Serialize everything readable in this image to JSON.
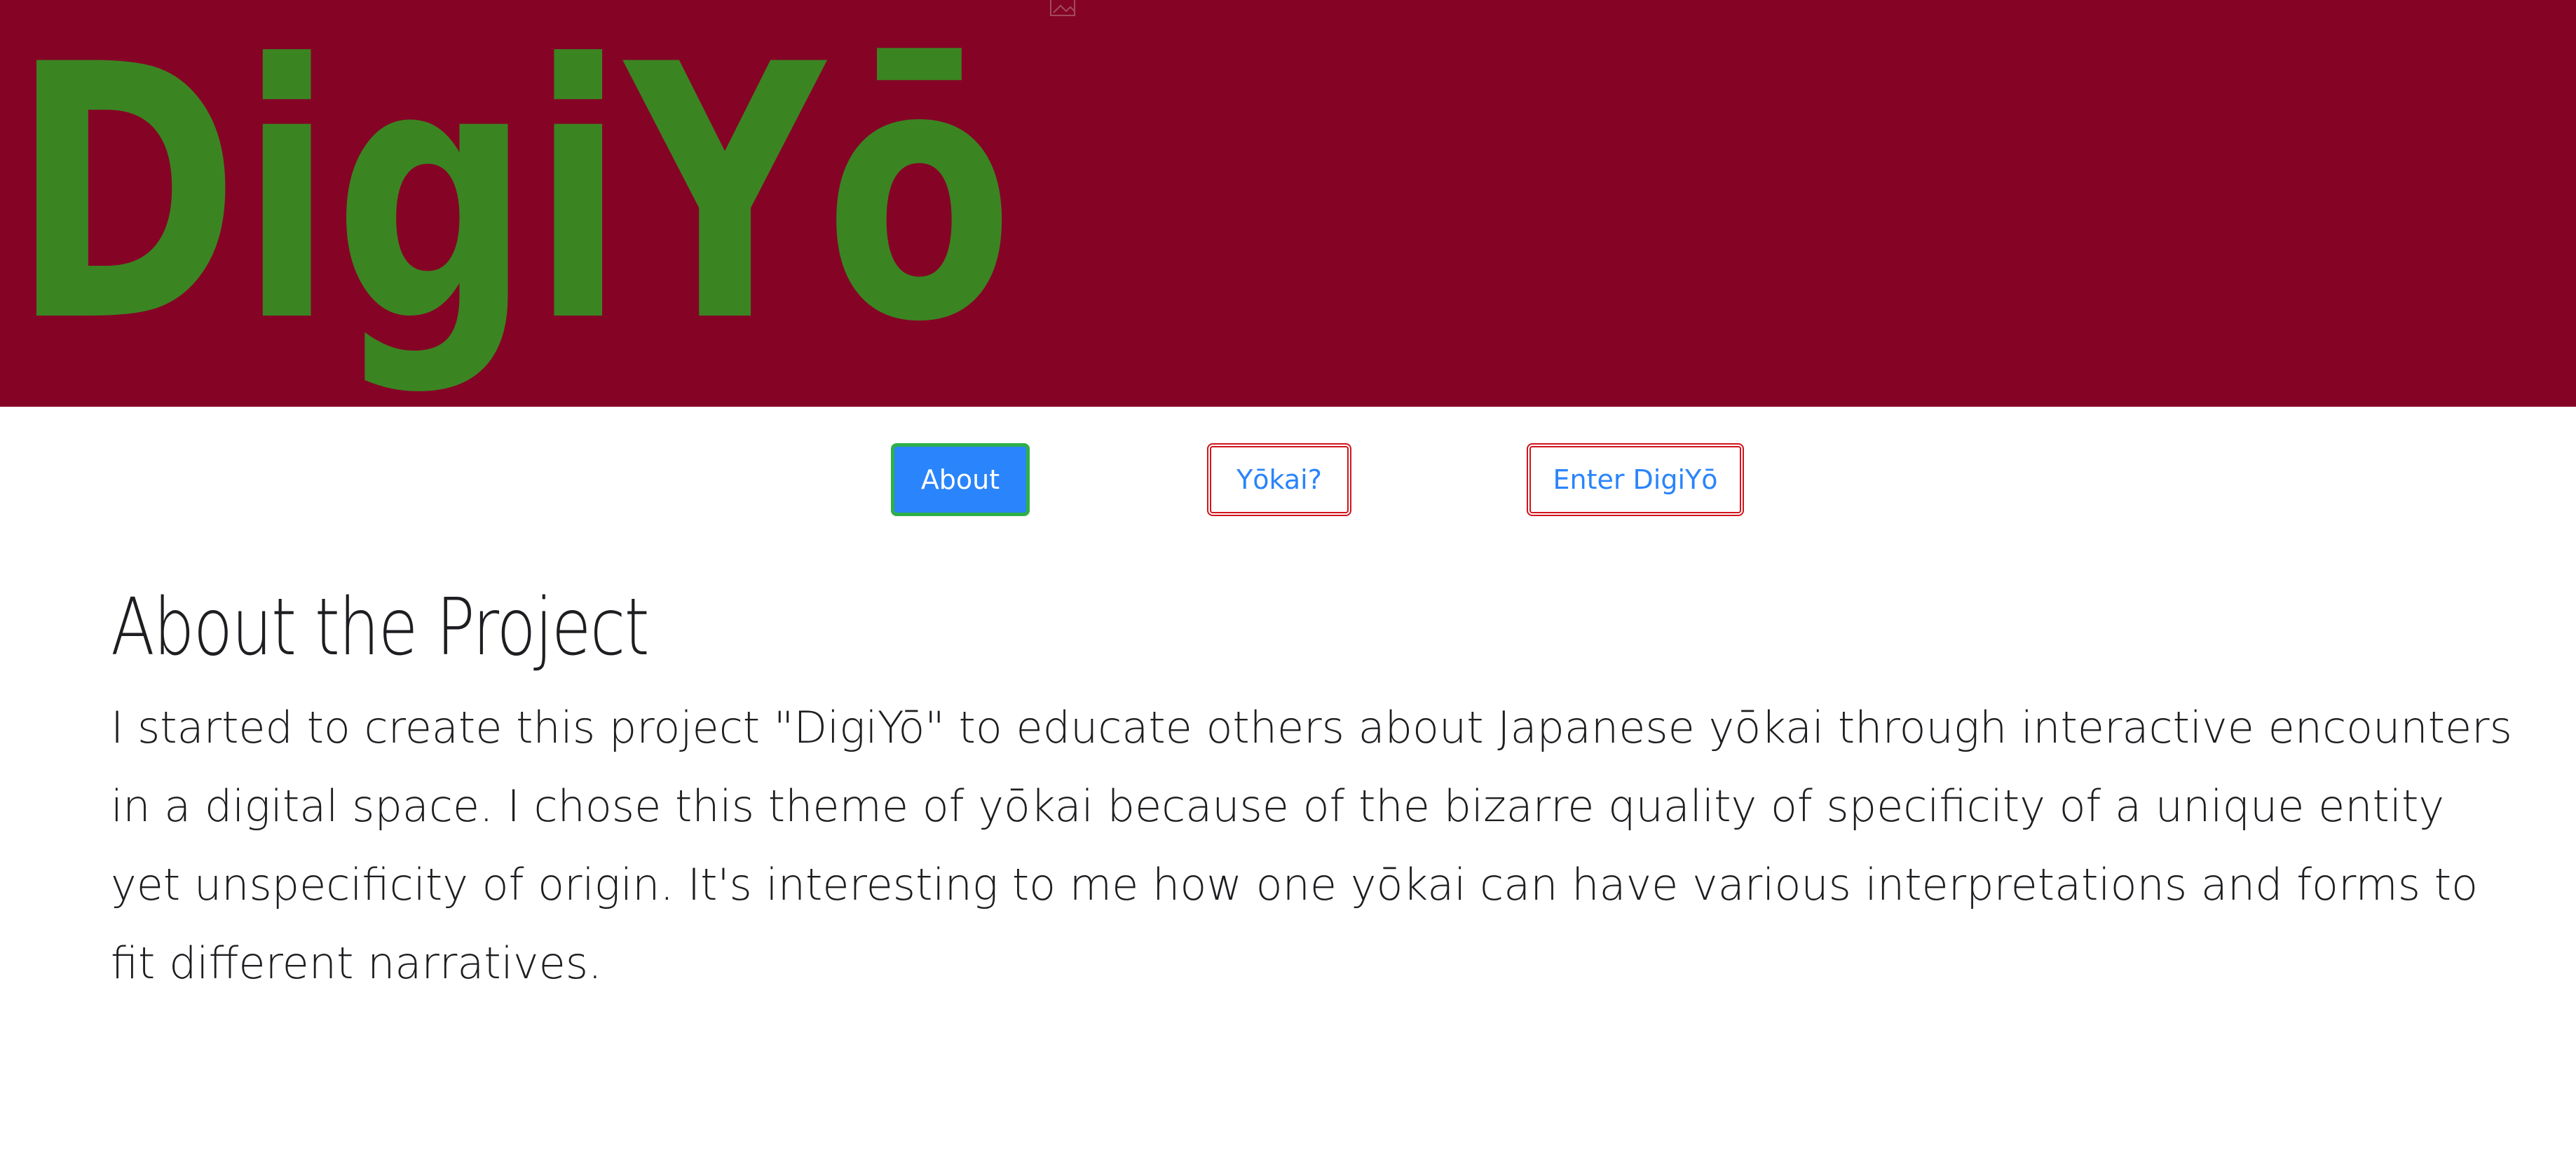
{
  "header": {
    "logo_text": "DigiYō",
    "background_color": "#850426",
    "logo_color": "#3b8422",
    "broken_image_icon": "broken-image-icon"
  },
  "nav": {
    "buttons": [
      {
        "label": "About",
        "style": "primary",
        "active": true
      },
      {
        "label": "Yōkai?",
        "style": "outline"
      },
      {
        "label": "Enter DigiYō",
        "style": "outline"
      }
    ],
    "primary_color": "#2a84fb",
    "focus_ring_color": "#2eaf4a",
    "outline_border_color": "#d0141c"
  },
  "main": {
    "title": "About the Project",
    "paragraph": "I started to create this project \"DigiYō\" to educate others about Japanese yōkai through interactive encounters in a digital space. I chose this theme of yōkai because of the bizarre quality of specificity of a unique entity yet unspecificity of origin. It's interesting to me how one yōkai can have various interpretations and forms to fit different narratives."
  }
}
